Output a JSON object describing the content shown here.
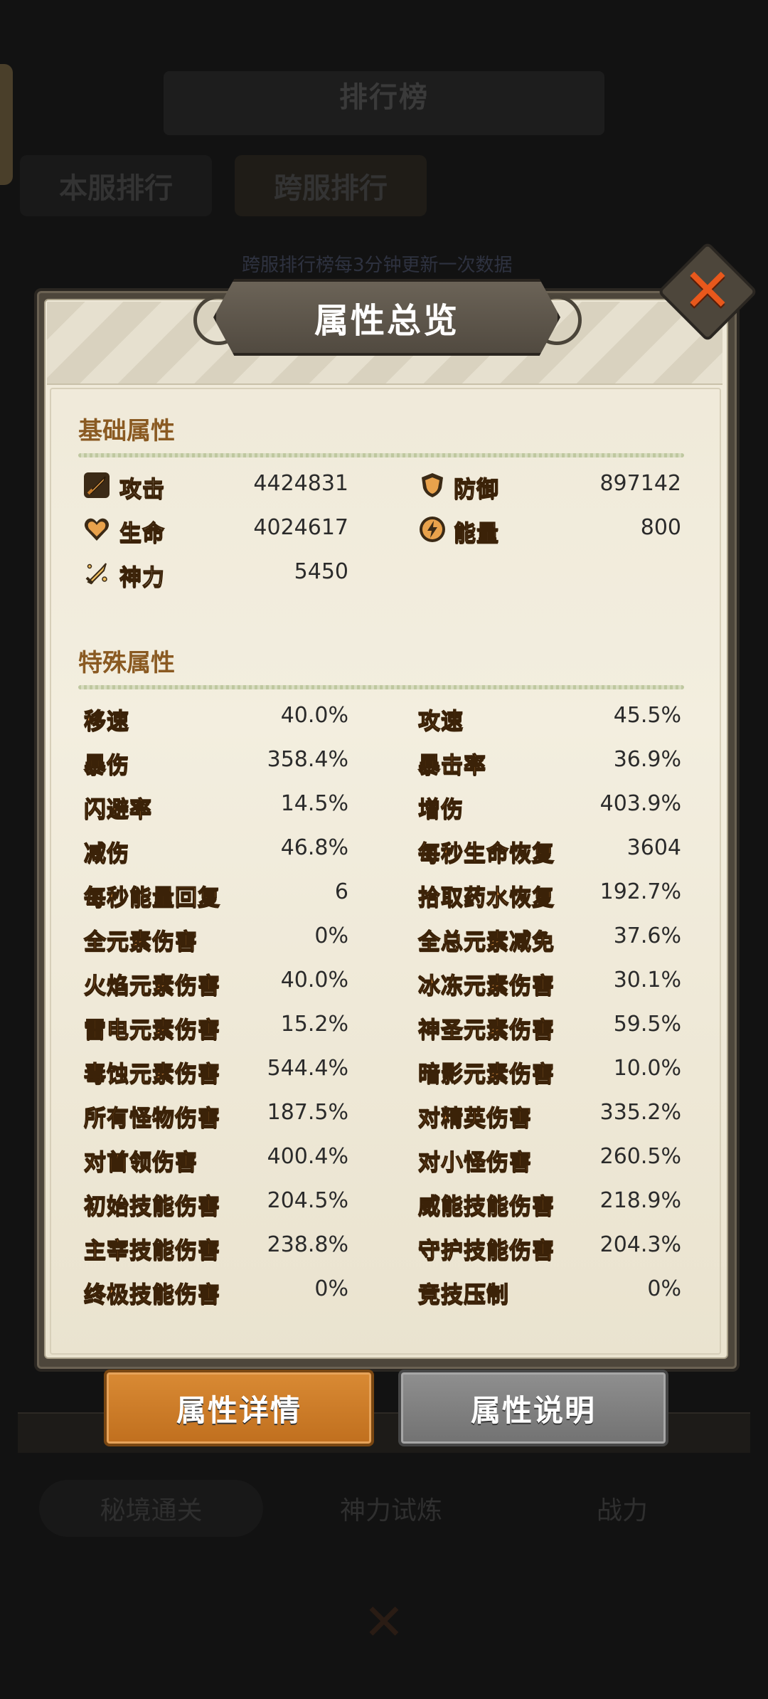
{
  "background": {
    "title": "排行榜",
    "tabs": [
      "本服排行",
      "跨服排行"
    ],
    "note": "跨服排行榜每3分钟更新一次数据",
    "bottom_tabs": [
      "秘境通关",
      "神力试炼",
      "战力"
    ]
  },
  "modal": {
    "title": "属性总览",
    "close_icon": "close-x-icon",
    "basic": {
      "title": "基础属性",
      "stats": [
        {
          "label": "攻击",
          "value": "4424831",
          "icon": "sword-icon"
        },
        {
          "label": "防御",
          "value": "897142",
          "icon": "shield-icon"
        },
        {
          "label": "生命",
          "value": "4024617",
          "icon": "heart-icon"
        },
        {
          "label": "能量",
          "value": "800",
          "icon": "energy-icon"
        },
        {
          "label": "神力",
          "value": "5450",
          "icon": "divine-sword-icon"
        }
      ]
    },
    "special": {
      "title": "特殊属性",
      "stats": [
        {
          "label": "移速",
          "value": "40.0%"
        },
        {
          "label": "攻速",
          "value": "45.5%"
        },
        {
          "label": "暴伤",
          "value": "358.4%"
        },
        {
          "label": "暴击率",
          "value": "36.9%"
        },
        {
          "label": "闪避率",
          "value": "14.5%"
        },
        {
          "label": "增伤",
          "value": "403.9%"
        },
        {
          "label": "减伤",
          "value": "46.8%"
        },
        {
          "label": "每秒生命恢复",
          "value": "3604"
        },
        {
          "label": "每秒能量回复",
          "value": "6"
        },
        {
          "label": "拾取药水恢复",
          "value": "192.7%"
        },
        {
          "label": "全元素伤害",
          "value": "0%"
        },
        {
          "label": "全总元素减免",
          "value": "37.6%"
        },
        {
          "label": "火焰元素伤害",
          "value": "40.0%"
        },
        {
          "label": "冰冻元素伤害",
          "value": "30.1%"
        },
        {
          "label": "雷电元素伤害",
          "value": "15.2%"
        },
        {
          "label": "神圣元素伤害",
          "value": "59.5%"
        },
        {
          "label": "毒蚀元素伤害",
          "value": "544.4%"
        },
        {
          "label": "暗影元素伤害",
          "value": "10.0%"
        },
        {
          "label": "所有怪物伤害",
          "value": "187.5%"
        },
        {
          "label": "对精英伤害",
          "value": "335.2%"
        },
        {
          "label": "对首领伤害",
          "value": "400.4%"
        },
        {
          "label": "对小怪伤害",
          "value": "260.5%"
        },
        {
          "label": "初始技能伤害",
          "value": "204.5%"
        },
        {
          "label": "威能技能伤害",
          "value": "218.9%"
        },
        {
          "label": "主宰技能伤害",
          "value": "238.8%"
        },
        {
          "label": "守护技能伤害",
          "value": "204.3%"
        },
        {
          "label": "终极技能伤害",
          "value": "0%"
        },
        {
          "label": "竞技压制",
          "value": "0%"
        }
      ]
    },
    "buttons": {
      "detail": "属性详情",
      "description": "属性说明"
    }
  },
  "colors": {
    "accent_orange": "#f2a250",
    "active_button": "#d98a34",
    "inactive_button": "#8f8f8f",
    "close_red": "#e8581c",
    "section_title": "#8a5a22"
  }
}
